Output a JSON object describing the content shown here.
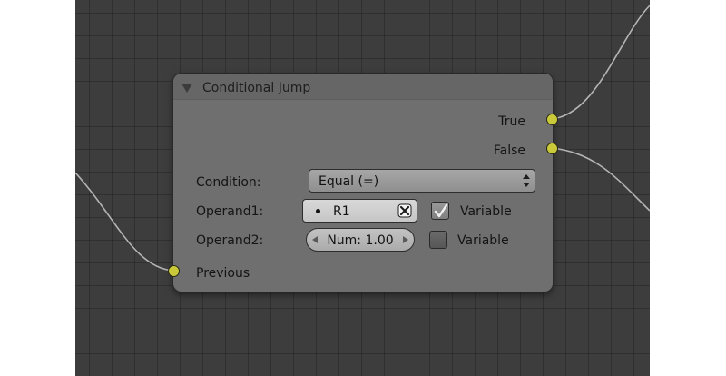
{
  "node": {
    "title": "Conditional Jump",
    "outputs": [
      {
        "label": "True"
      },
      {
        "label": "False"
      }
    ],
    "inputs": [
      {
        "label": "Previous"
      }
    ],
    "condition": {
      "label": "Condition:",
      "value": "Equal (=)"
    },
    "operand1": {
      "label": "Operand1:",
      "value": "R1",
      "variable_label": "Variable",
      "variable_checked": true
    },
    "operand2": {
      "label": "Operand2:",
      "value": "Num: 1.00",
      "variable_label": "Variable",
      "variable_checked": false
    }
  },
  "colors": {
    "canvas": "#3d3d3d",
    "node_body": "#6f6f6f",
    "socket": "#c9c93a",
    "link": "#b4b4b4"
  },
  "icons": {
    "collapse": "triangle-down-icon",
    "condition_dropdown": "up-down-arrows-icon",
    "operand1_clear": "x-icon",
    "operand1_dot": "dot-icon",
    "operand2_decrement": "arrow-left-icon",
    "operand2_increment": "arrow-right-icon",
    "checkbox_checked": "checkmark-icon"
  }
}
